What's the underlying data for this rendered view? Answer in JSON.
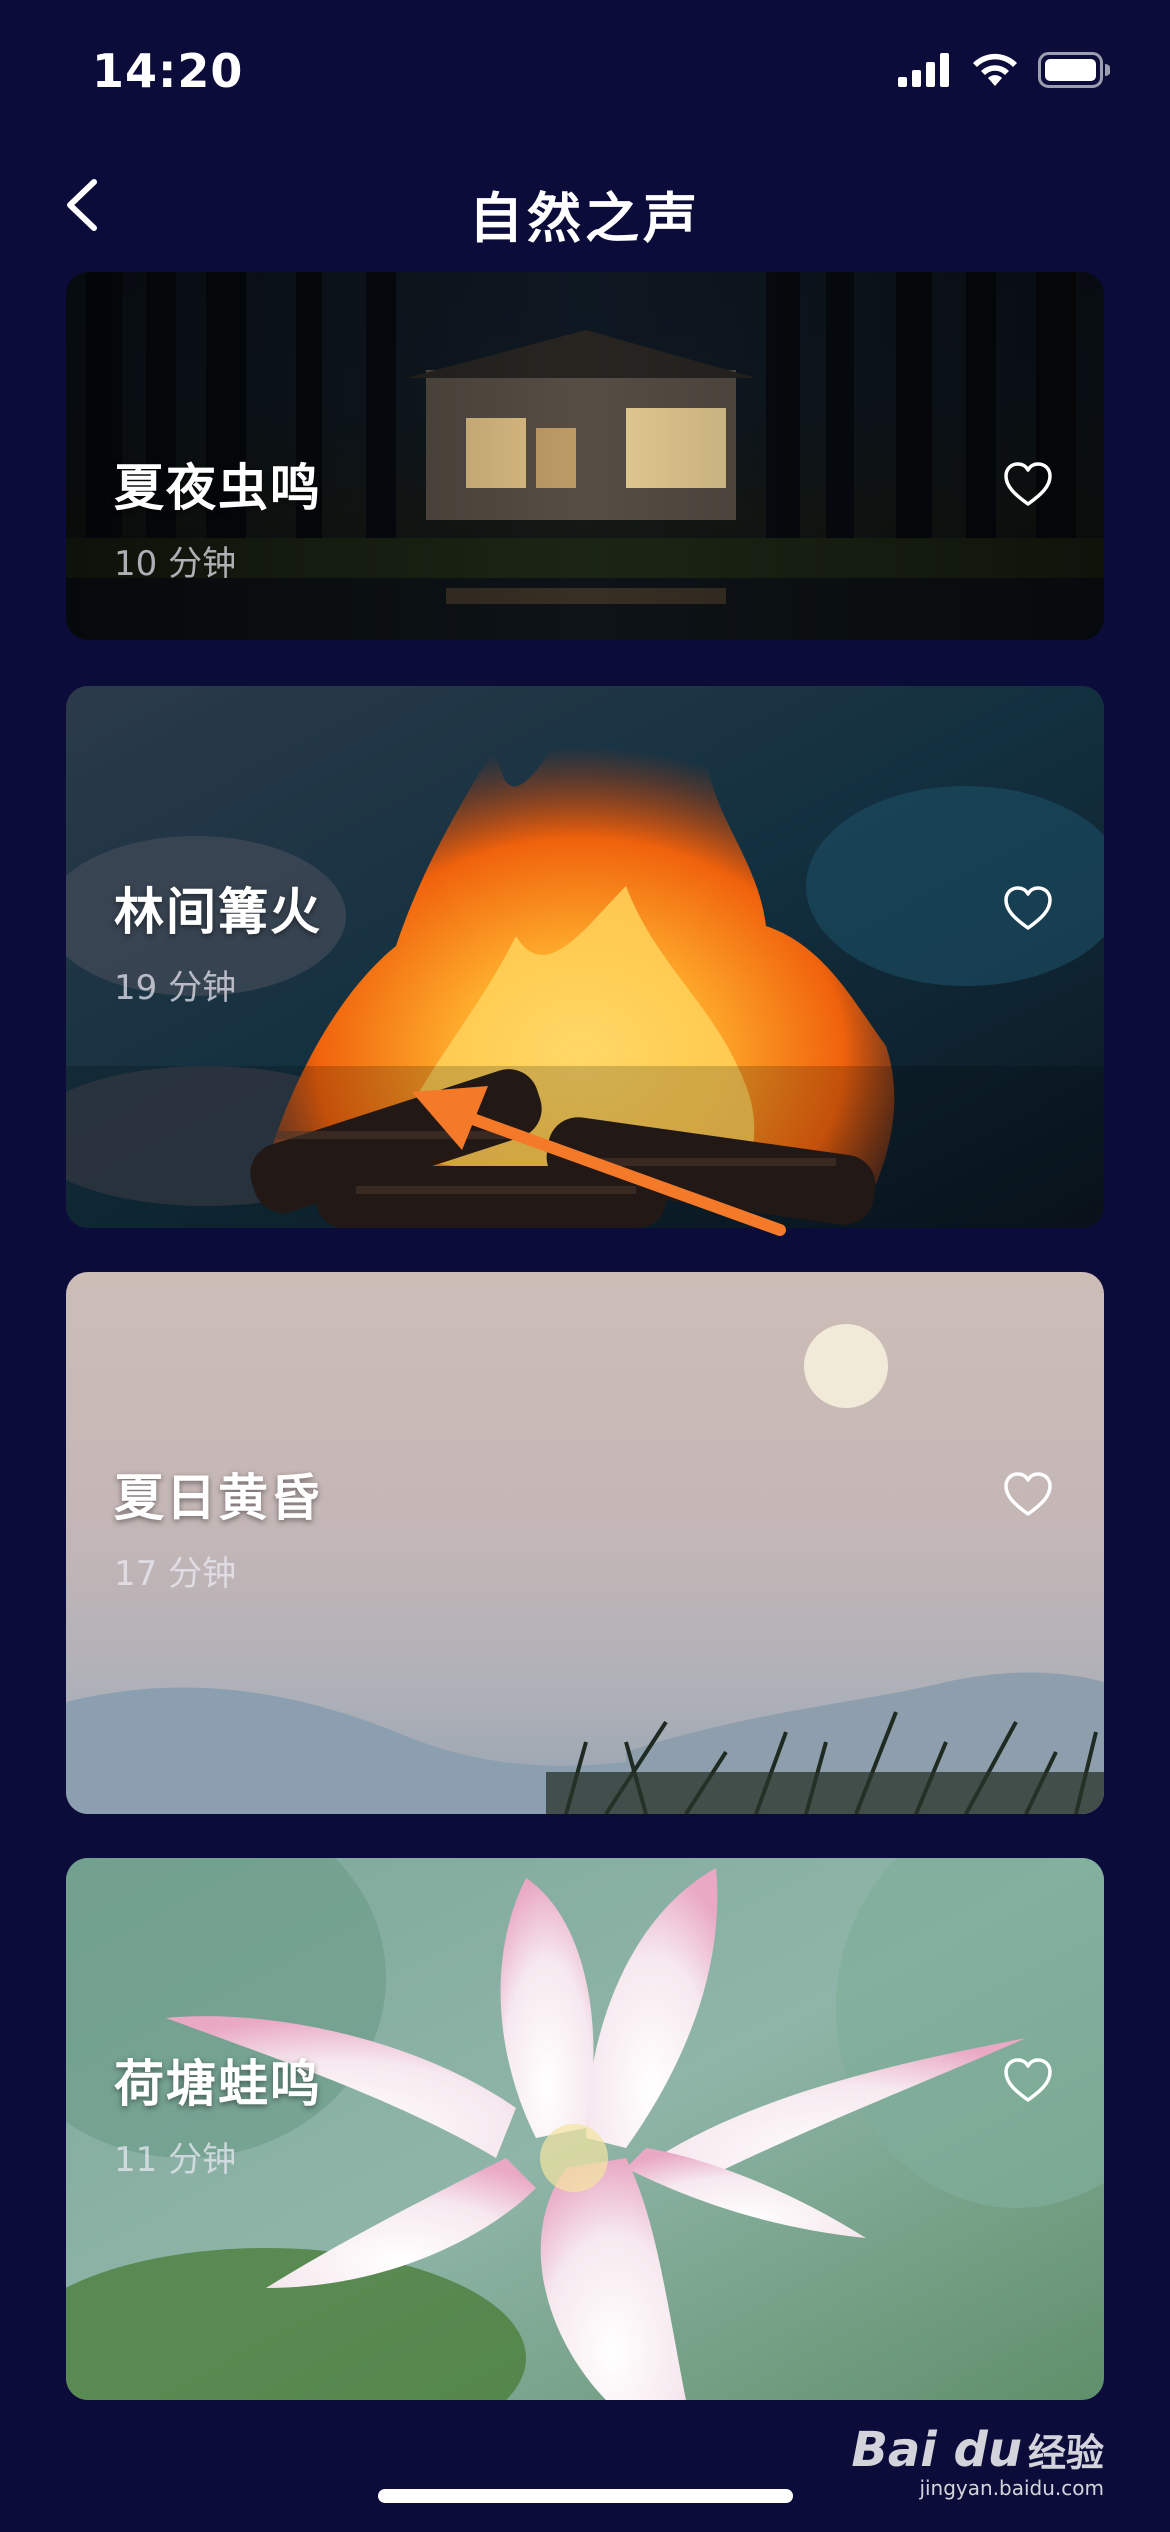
{
  "status_bar": {
    "time": "14:20"
  },
  "header": {
    "title": "自然之声"
  },
  "list": {
    "items": [
      {
        "title": "夏夜虫鸣",
        "duration": "10 分钟"
      },
      {
        "title": "林间篝火",
        "duration": "19 分钟"
      },
      {
        "title": "夏日黄昏",
        "duration": "17 分钟"
      },
      {
        "title": "荷塘蛙鸣",
        "duration": "11 分钟"
      }
    ]
  },
  "watermark": {
    "logo": "Bai du",
    "text": "经验",
    "url": "jingyan.baidu.com"
  },
  "colors": {
    "background": "#0c0c3a",
    "annotation_arrow": "#f47a2a"
  }
}
